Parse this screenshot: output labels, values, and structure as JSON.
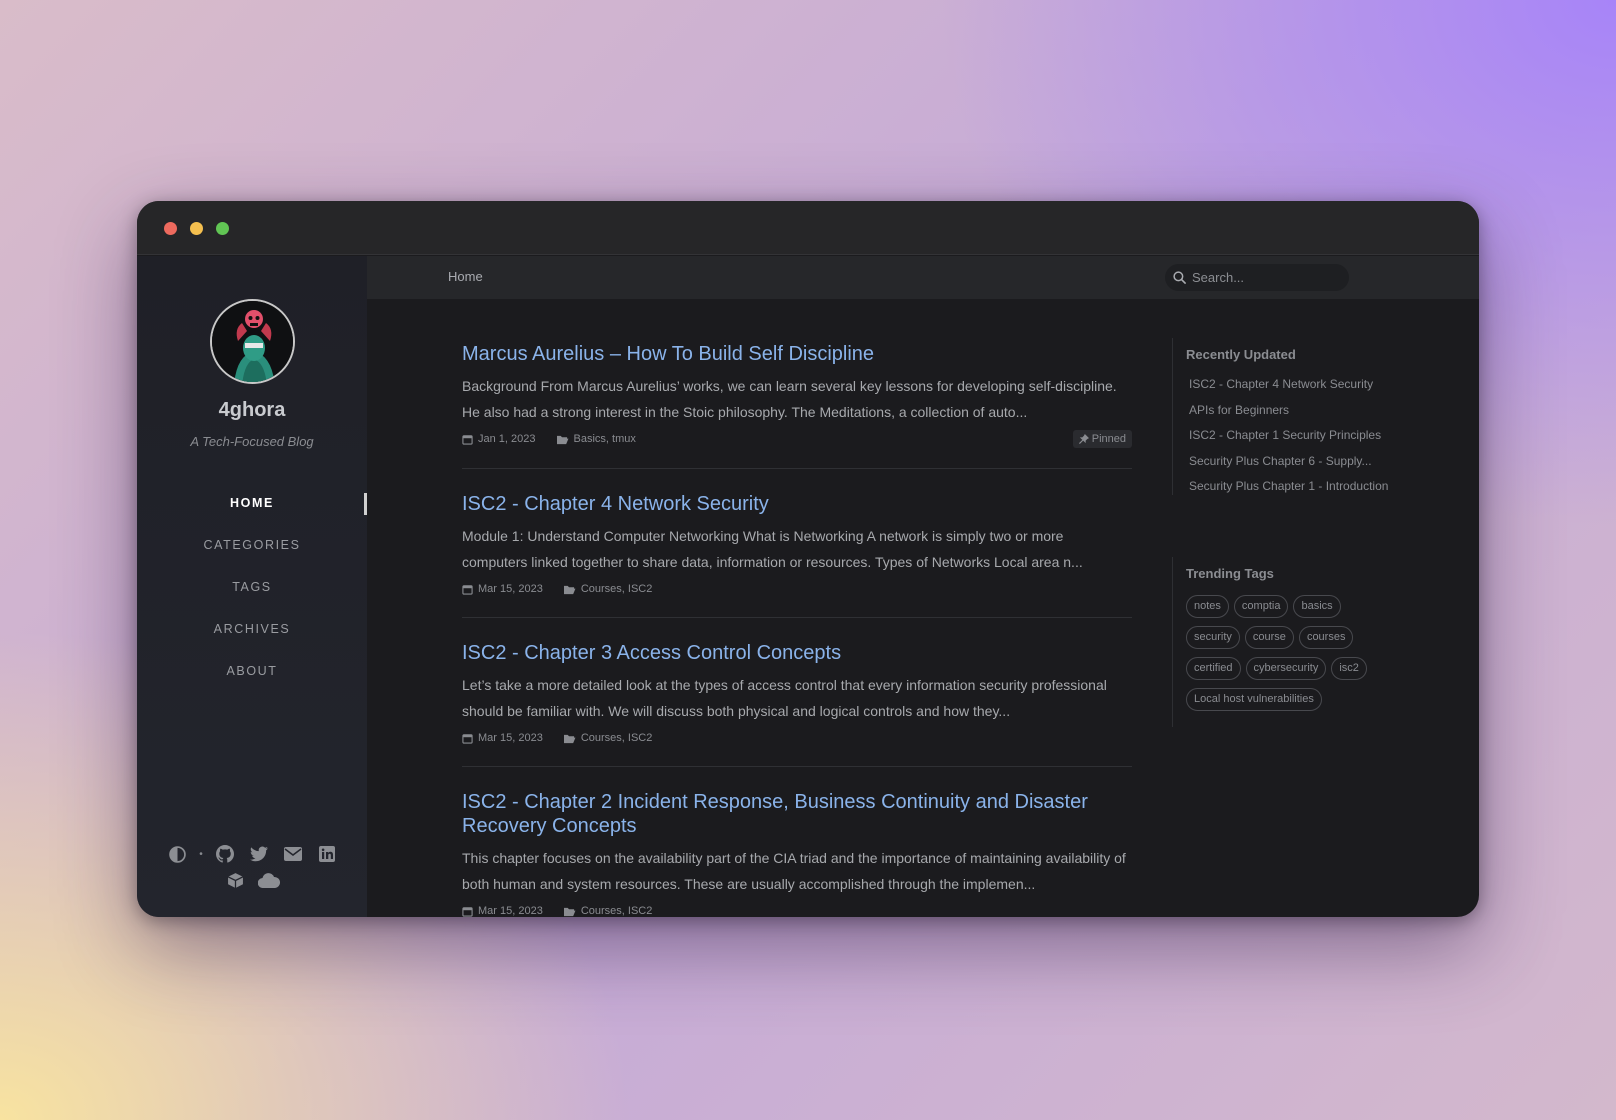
{
  "window": {
    "controls": [
      "close",
      "minimize",
      "maximize"
    ]
  },
  "sidebar": {
    "avatar_icon": "skull-character-avatar",
    "site_title": "4ghora",
    "site_subtitle": "A Tech-Focused Blog",
    "nav": [
      {
        "label": "HOME",
        "active": true
      },
      {
        "label": "CATEGORIES",
        "active": false
      },
      {
        "label": "TAGS",
        "active": false
      },
      {
        "label": "ARCHIVES",
        "active": false
      },
      {
        "label": "ABOUT",
        "active": false
      }
    ],
    "social_icons": [
      "theme-toggle-icon",
      "github-icon",
      "twitter-icon",
      "email-icon",
      "linkedin-icon",
      "package-icon",
      "cloud-icon"
    ]
  },
  "topbar": {
    "breadcrumb": "Home",
    "search_placeholder": "Search..."
  },
  "posts": [
    {
      "title": "Marcus Aurelius – How To Build Self Discipline",
      "excerpt": "Background From Marcus Aurelius’ works, we can learn several key lessons for developing self-discipline. He also had a strong interest in the Stoic philosophy. The Meditations, a collection of auto...",
      "date": "Jan 1, 2023",
      "categories": "Basics, tmux",
      "badge": "Pinned"
    },
    {
      "title": "ISC2 - Chapter 4 Network Security",
      "excerpt": "Module 1: Understand Computer Networking What is Networking A network is simply two or more computers linked together to share data, information or resources. Types of Networks Local area n...",
      "date": "Mar 15, 2023",
      "categories": "Courses, ISC2"
    },
    {
      "title": "ISC2 - Chapter 3 Access Control Concepts",
      "excerpt": "Let’s take a more detailed look at the types of access control that every information security professional should be familiar with. We will discuss both physical and logical controls and how they...",
      "date": "Mar 15, 2023",
      "categories": "Courses, ISC2"
    },
    {
      "title": "ISC2 - Chapter 2 Incident Response, Business Continuity and Disaster Recovery Concepts",
      "excerpt": "This chapter focuses on the availability part of the CIA triad and the importance of maintaining availability of both human and system resources. These are usually accomplished through the implemen...",
      "date": "Mar 15, 2023",
      "categories": "Courses, ISC2"
    }
  ],
  "recently_updated": {
    "heading": "Recently Updated",
    "items": [
      "ISC2 - Chapter 4 Network Security",
      "APIs for Beginners",
      "ISC2 - Chapter 1 Security Principles",
      "Security Plus Chapter 6 - Supply...",
      "Security Plus Chapter 1 - Introduction"
    ]
  },
  "trending_tags": {
    "heading": "Trending Tags",
    "tags": [
      "notes",
      "comptia",
      "basics",
      "security",
      "course",
      "courses",
      "certified",
      "cybersecurity",
      "isc2",
      "Local host vulnerabilities"
    ]
  },
  "colors": {
    "link": "#8ab3ea",
    "background": "#1b1b1e",
    "sidebar": "#202129"
  }
}
